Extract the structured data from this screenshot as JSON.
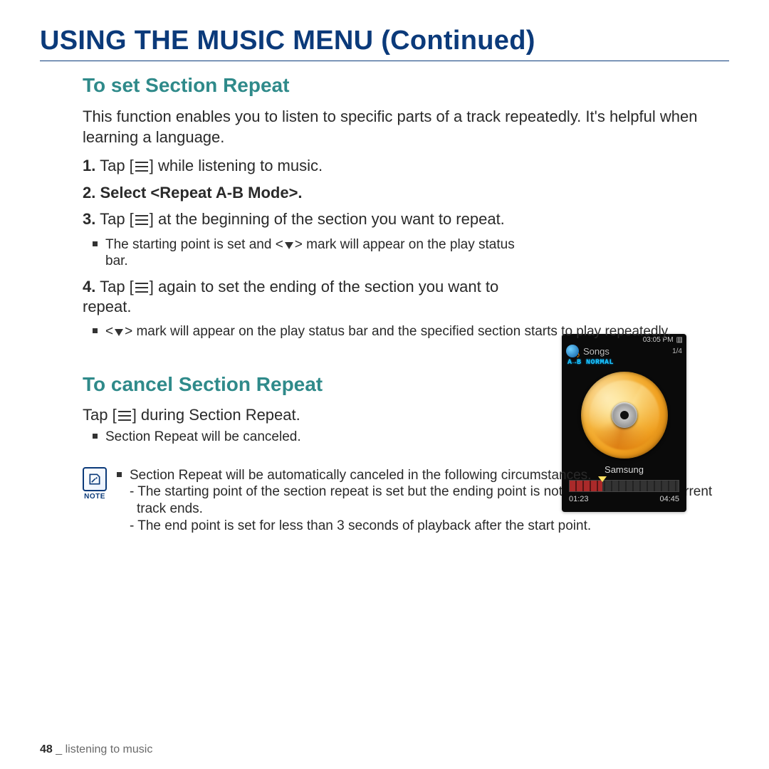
{
  "page_title": "USING THE MUSIC MENU (Continued)",
  "section_set": {
    "heading": "To set Section Repeat",
    "intro": "This function enables you to listen to specific parts of a track repeatedly. It's helpful when learning a language.",
    "step1_pre": "Tap [",
    "step1_post": "] while listening to music.",
    "step2": "Select <Repeat A-B Mode>.",
    "step3_pre": "Tap [",
    "step3_post": "] at the beginning of the section you want to repeat.",
    "step3_note_pre": "The starting point is set and <",
    "step3_note_post": "> mark will appear on the play status bar.",
    "step4_pre": "Tap [",
    "step4_post": "] again to set the ending of the section you want to repeat.",
    "step4_note_pre": "<",
    "step4_note_post": "> mark will appear on the play status bar and the specified section starts to play repeatedly."
  },
  "section_cancel": {
    "heading": "To cancel Section Repeat",
    "tap_pre": "Tap [",
    "tap_post": "] during Section Repeat.",
    "result": "Section Repeat will be canceled."
  },
  "note_block": {
    "label": "NOTE",
    "lead": "Section Repeat will be automatically canceled in the following circumstances.",
    "dash1": "- The starting point of the section repeat is set but the ending point is not set until after the current track ends.",
    "dash2": "- The end point is set for less than 3 seconds of playback after the start point."
  },
  "device": {
    "clock": "03:05 PM",
    "header_title": "Songs",
    "header_count": "1/4",
    "mode_text": "A→B NORMAL",
    "track": "Samsung",
    "time_elapsed": "01:23",
    "time_total": "04:45"
  },
  "footer": {
    "page_number": "48",
    "separator": "_",
    "section_name": "listening to music"
  }
}
